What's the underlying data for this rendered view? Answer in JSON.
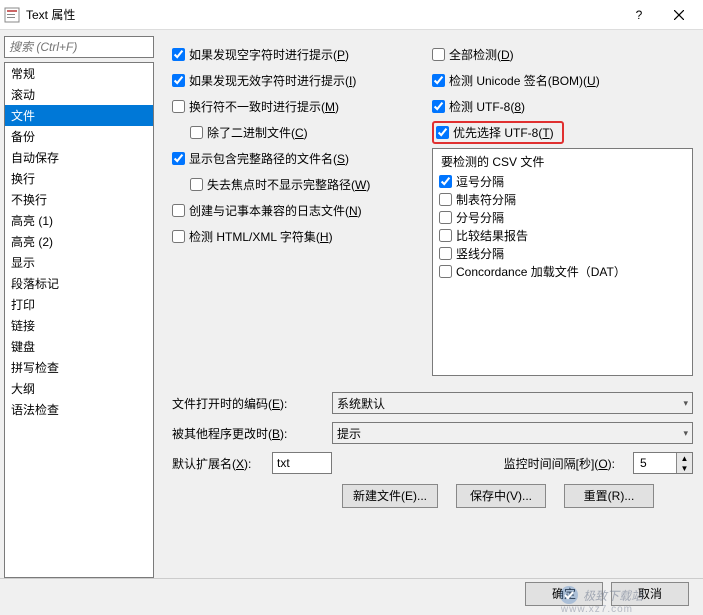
{
  "title": "Text 属性",
  "search_placeholder": "搜索 (Ctrl+F)",
  "categories": [
    "常规",
    "滚动",
    "文件",
    "备份",
    "自动保存",
    "换行",
    "不换行",
    "高亮 (1)",
    "高亮 (2)",
    "显示",
    "段落标记",
    "打印",
    "链接",
    "键盘",
    "拼写检查",
    "大纲",
    "语法检查"
  ],
  "selected_category_index": 2,
  "left_checks": {
    "prompt_empty": {
      "label": "如果发现空字符时进行提示(",
      "u": "P",
      "suffix": ")",
      "checked": true
    },
    "prompt_invalid": {
      "label": "如果发现无效字符时进行提示(",
      "u": "I",
      "suffix": ")",
      "checked": true
    },
    "newline_mismatch": {
      "label": "换行符不一致时进行提示(",
      "u": "M",
      "suffix": ")",
      "checked": false
    },
    "exclude_binary": {
      "label": "除了二进制文件(",
      "u": "C",
      "suffix": ")",
      "checked": false
    },
    "show_full_path": {
      "label": "显示包含完整路径的文件名(",
      "u": "S",
      "suffix": ")",
      "checked": true
    },
    "hide_path_unfocus": {
      "label": "失去焦点时不显示完整路径(",
      "u": "W",
      "suffix": ")",
      "checked": false
    },
    "notepad_log": {
      "label": "创建与记事本兼容的日志文件(",
      "u": "N",
      "suffix": ")",
      "checked": false
    },
    "detect_html": {
      "label": "检测 HTML/XML 字符集(",
      "u": "H",
      "suffix": ")",
      "checked": false
    }
  },
  "right_checks": {
    "detect_all": {
      "label": "全部检测(",
      "u": "D",
      "suffix": ")",
      "checked": false
    },
    "detect_unicode": {
      "label": "检测 Unicode 签名(BOM)(",
      "u": "U",
      "suffix": ")",
      "checked": true
    },
    "detect_utf8": {
      "label": "检测 UTF-8(",
      "u": "8",
      "suffix": ")",
      "checked": true
    },
    "prefer_utf8": {
      "label": "优先选择 UTF-8(",
      "u": "T",
      "suffix": ")",
      "checked": true
    }
  },
  "csv": {
    "title": "要检测的 CSV 文件",
    "items": [
      {
        "label": "逗号分隔",
        "checked": true
      },
      {
        "label": "制表符分隔",
        "checked": false
      },
      {
        "label": "分号分隔",
        "checked": false
      },
      {
        "label": "比较结果报告",
        "checked": false
      },
      {
        "label": "竖线分隔",
        "checked": false
      },
      {
        "label": "Concordance 加载文件（DAT）",
        "checked": false
      }
    ]
  },
  "form": {
    "encoding_label_pre": "文件打开时的编码(",
    "encoding_u": "E",
    "encoding_suffix": "):",
    "encoding_value": "系统默认",
    "changed_label_pre": "被其他程序更改时(",
    "changed_u": "B",
    "changed_suffix": "):",
    "changed_value": "提示",
    "ext_label_pre": "默认扩展名(",
    "ext_u": "X",
    "ext_suffix": "):",
    "ext_value": "txt",
    "monitor_label_pre": "监控时间间隔[秒](",
    "monitor_u": "O",
    "monitor_suffix": "):",
    "monitor_value": "5"
  },
  "buttons": {
    "new_file": "新建文件(E)...",
    "save_in": "保存中(V)...",
    "reset": "重置(R)..."
  },
  "footer": {
    "ok": "确定",
    "cancel": "取消"
  },
  "watermark": {
    "main": "极致下载站",
    "sub": "www.xz7.com"
  }
}
